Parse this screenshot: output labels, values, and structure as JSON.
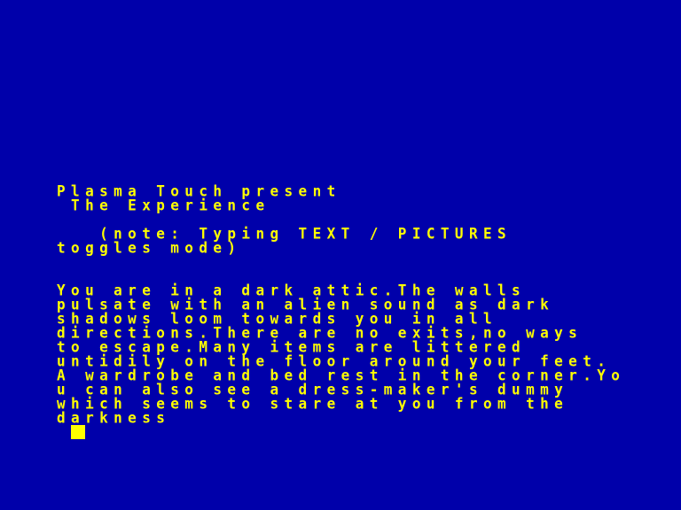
{
  "colors": {
    "background": "#0000aa",
    "text": "#ffff00"
  },
  "header": {
    "line1": "Plasma Touch present",
    "line2": " The Experience"
  },
  "note": {
    "line1": "   (note: Typing TEXT / PICTURES",
    "line2": "toggles mode)"
  },
  "description": {
    "lines": [
      "You are in a dark attic.The walls",
      "pulsate with an alien sound as dark",
      "shadows loom towards you in all",
      "directions.There are no exits,no ways",
      "to escape.Many items are littered",
      "untidily on the floor around your feet.",
      "A wardrobe and bed rest in the corner.Yo",
      "u can also see a dress-maker's dummy",
      "which seems to stare at you from the",
      "darkness"
    ]
  },
  "prompt": {
    "cursor": "block-cursor"
  }
}
